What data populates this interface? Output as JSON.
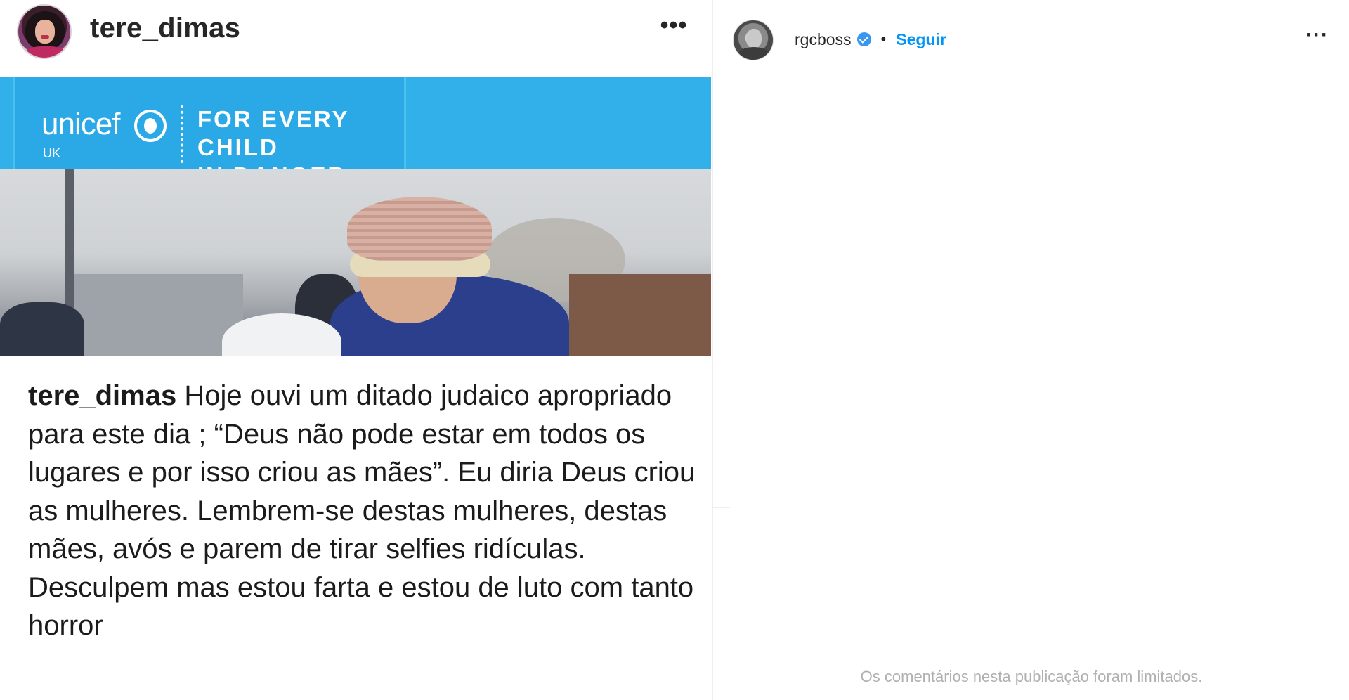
{
  "left_post": {
    "username": "tere_dimas",
    "more_icon": "•••",
    "banner": {
      "logo_text": "unicef",
      "logo_sub": "UK",
      "tagline_line1": "FOR EVERY CHILD",
      "tagline_line2": "IN DANGER",
      "color": "#31b0ea"
    },
    "caption": {
      "username": "tere_dimas",
      "text": " Hoje ouvi um ditado judaico apropriado para este dia ; “Deus não pode estar em todos os lugares e por isso criou as mães”. Eu diria Deus criou as mulheres. Lembrem-se destas mulheres, destas mães, avós e parem de tirar selfies ridículas. Desculpem mas estou farta e estou de luto com tanto horror"
    }
  },
  "right_panel": {
    "username": "rgcboss",
    "verified_icon": "verified-badge-icon",
    "separator": "•",
    "follow_label": "Seguir",
    "more_icon": "···",
    "footer_note": "Os comentários nesta publicação foram limitados.",
    "accent_color": "#0095f6"
  }
}
